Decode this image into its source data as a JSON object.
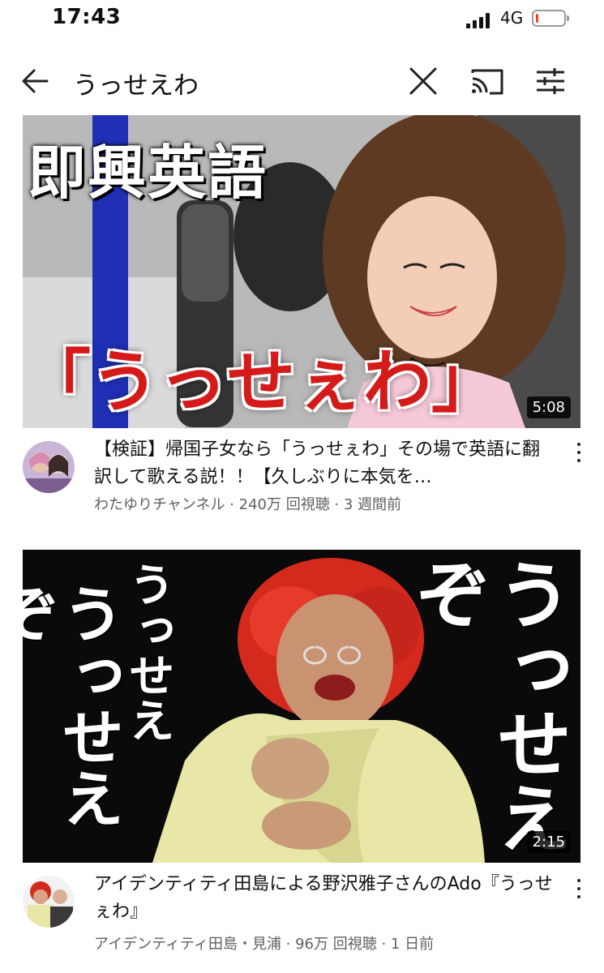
{
  "status_bar": {
    "time": "17:43",
    "network": "4G",
    "battery_level": 0.1
  },
  "search": {
    "query": "うっせえわ"
  },
  "icons": {
    "back": "arrow-left-icon",
    "clear": "close-icon",
    "cast": "cast-icon",
    "filter": "filter-sliders-icon",
    "more": "more-vertical-icon"
  },
  "videos": [
    {
      "thumbnail_text_top": "即興英語",
      "thumbnail_text_bottom": "「うっせぇわ」",
      "duration": "5:08",
      "title": "【検証】帰国子女なら「うっせぇわ」その場で英語に翻訳して歌える説！！【久しぶりに本気を…",
      "meta": "わたゆりチャンネル · 240万 回視聴 · 3 週間前"
    },
    {
      "thumbnail_text_left": "うっせえうっせえぞ",
      "thumbnail_text_right": "うっせえぞ",
      "duration": "2:15",
      "title": "アイデンティティ田島による野沢雅子さんのAdo『うっせぇわ』",
      "meta": "アイデンティティ田島・見浦 · 96万 回視聴 · 1 日前"
    }
  ],
  "colors": {
    "accent_red": "#d51a1a",
    "meta_gray": "#606060",
    "battery_low": "#ff3b30"
  }
}
